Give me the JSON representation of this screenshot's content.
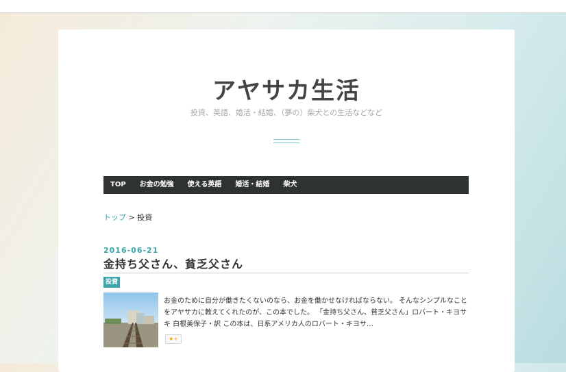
{
  "site": {
    "title": "アヤサカ生活",
    "description": "投資、英語、婚活・結婚、（夢の）柴犬との生活などなど"
  },
  "nav": {
    "items": [
      {
        "label": "TOP"
      },
      {
        "label": "お金の勉強"
      },
      {
        "label": "使える英語"
      },
      {
        "label": "婚活・結婚"
      },
      {
        "label": "柴犬"
      }
    ]
  },
  "breadcrumb": {
    "home": "トップ",
    "separator": " > ",
    "current": "投資"
  },
  "post": {
    "date": "2016-06-21",
    "title": "金持ち父さん、貧乏父さん",
    "category": "投資",
    "excerpt": "お金のために自分が働きたくないのなら、お金を働かせなければならない。 そんなシンプルなことをアヤサカに教えてくれたのが、この本でした。 「金持ち父さん、貧乏父さん」ロバート・キヨサキ 白根美保子・訳 この本は、日系アメリカ人のロバート・キヨサ…",
    "star_icon": "star-plus-icon",
    "star_label": "★+"
  },
  "colors": {
    "accent": "#3aa5ad",
    "nav_bg": "#2f3233",
    "title": "#444444"
  }
}
